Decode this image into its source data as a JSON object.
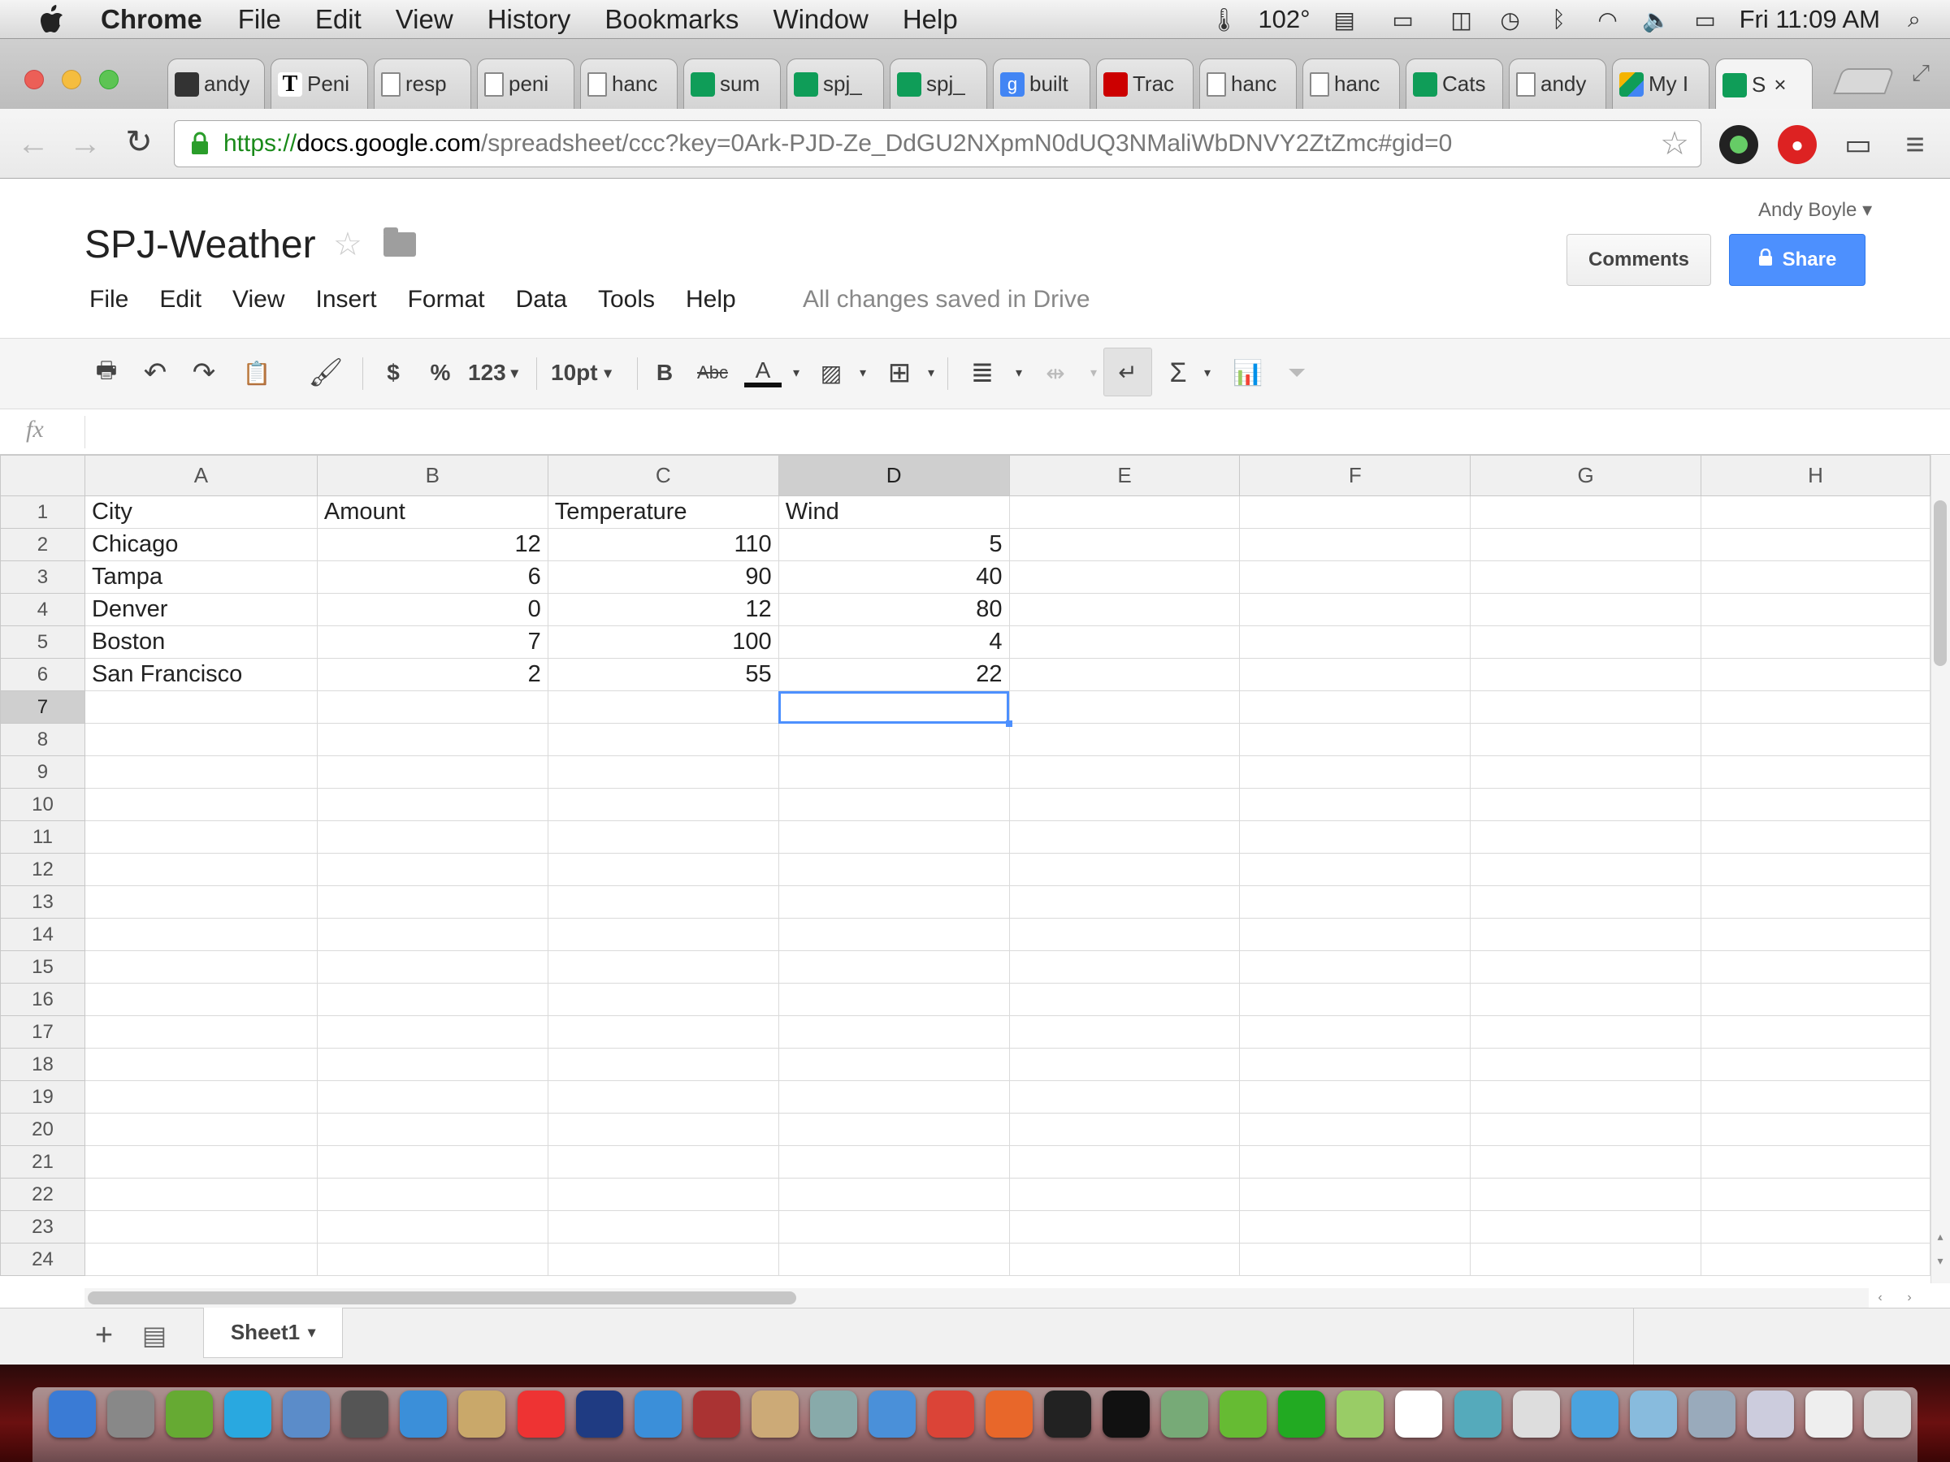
{
  "menubar": {
    "app": "Chrome",
    "items": [
      "File",
      "Edit",
      "View",
      "History",
      "Bookmarks",
      "Window",
      "Help"
    ],
    "temperature": "102°",
    "clock": "Fri 11:09 AM"
  },
  "tabs": [
    {
      "label": "andy",
      "icon": "fav-dark"
    },
    {
      "label": "Peni",
      "icon": "fav-t"
    },
    {
      "label": "resp",
      "icon": "fav-doc"
    },
    {
      "label": "peni",
      "icon": "fav-doc"
    },
    {
      "label": "hanc",
      "icon": "fav-doc"
    },
    {
      "label": "sum",
      "icon": "fav-sheet"
    },
    {
      "label": "spj_",
      "icon": "fav-sheet"
    },
    {
      "label": "spj_",
      "icon": "fav-sheet"
    },
    {
      "label": "built",
      "icon": "fav-google"
    },
    {
      "label": "Trac",
      "icon": "fav-red"
    },
    {
      "label": "hanc",
      "icon": "fav-doc"
    },
    {
      "label": "hanc",
      "icon": "fav-doc"
    },
    {
      "label": "Cats",
      "icon": "fav-sheet"
    },
    {
      "label": "andy",
      "icon": "fav-doc"
    },
    {
      "label": "My I",
      "icon": "fav-drive"
    },
    {
      "label": "S",
      "icon": "fav-sheet"
    }
  ],
  "url": {
    "scheme": "https://",
    "host": "docs.google.com",
    "path": "/spreadsheet/ccc?key=0Ark-PJD-Ze_DdGU2NXpmN0dUQ3NMaliWbDNVY2ZtZmc#gid=0"
  },
  "doc": {
    "title": "SPJ-Weather",
    "menu": [
      "File",
      "Edit",
      "View",
      "Insert",
      "Format",
      "Data",
      "Tools",
      "Help"
    ],
    "save_status": "All changes saved in Drive",
    "user": "Andy Boyle",
    "comments_label": "Comments",
    "share_label": "Share"
  },
  "toolbar": {
    "currency": "$",
    "percent": "%",
    "number_format": "123",
    "font_size": "10pt",
    "bold": "B",
    "strike": "Abc",
    "text_color": "A",
    "sum": "Σ"
  },
  "formula_bar": {
    "label": "fx",
    "value": ""
  },
  "sheet": {
    "columns": [
      "A",
      "B",
      "C",
      "D",
      "E",
      "F",
      "G",
      "H"
    ],
    "selected_column": "D",
    "selected_row": 7,
    "row_count": 24,
    "rows": [
      [
        "City",
        "Amount",
        "Temperature",
        "Wind"
      ],
      [
        "Chicago",
        "12",
        "110",
        "5"
      ],
      [
        "Tampa",
        "6",
        "90",
        "40"
      ],
      [
        "Denver",
        "0",
        "12",
        "80"
      ],
      [
        "Boston",
        "7",
        "100",
        "4"
      ],
      [
        "San Francisco",
        "2",
        "55",
        "22"
      ]
    ],
    "tab_name": "Sheet1"
  },
  "colors": {
    "accent": "#4d90fe",
    "share_button": "#4d90fe",
    "dock_bg": "#6b1010"
  },
  "dock_icons": [
    "finder",
    "launchpad",
    "automator",
    "skype",
    "preview",
    "photo-booth",
    "safari",
    "notes",
    "calendar",
    "photoshop",
    "itunes",
    "photo-slideshow",
    "iphoto",
    "preview-2",
    "app-store",
    "chrome",
    "firefox",
    "terminal",
    "terminal-2",
    "textwrangler",
    "evernote",
    "growl",
    "coda",
    "github",
    "twitter",
    "textedit",
    "mail",
    "finder-folder",
    "documents",
    "downloads",
    "preview-3",
    "trash"
  ]
}
